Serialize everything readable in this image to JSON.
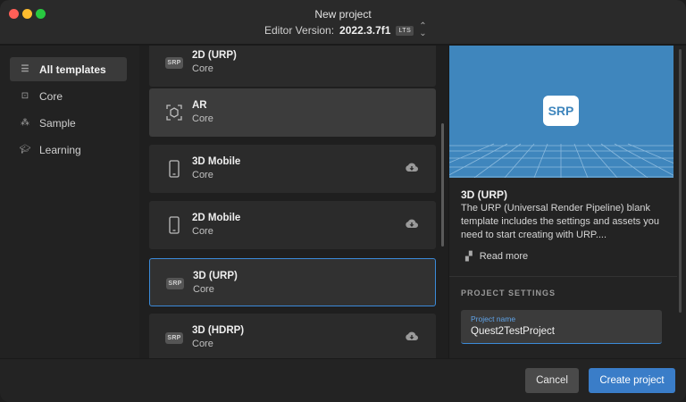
{
  "window": {
    "title": "New project"
  },
  "editor": {
    "label": "Editor Version:",
    "version": "2022.3.7f1",
    "badge": "LTS"
  },
  "sidebar": {
    "items": [
      {
        "label": "All templates",
        "icon": "list-icon",
        "active": true
      },
      {
        "label": "Core",
        "icon": "core-icon",
        "active": false
      },
      {
        "label": "Sample",
        "icon": "sample-icon",
        "active": false
      },
      {
        "label": "Learning",
        "icon": "graduation-cap-icon",
        "active": false
      }
    ]
  },
  "templates": [
    {
      "name": "2D (URP)",
      "category": "Core",
      "icon": "srp-icon",
      "download": false
    },
    {
      "name": "AR",
      "category": "Core",
      "icon": "ar-icon",
      "download": false
    },
    {
      "name": "3D Mobile",
      "category": "Core",
      "icon": "mobile-icon",
      "download": true
    },
    {
      "name": "2D Mobile",
      "category": "Core",
      "icon": "mobile-icon",
      "download": true
    },
    {
      "name": "3D (URP)",
      "category": "Core",
      "icon": "srp-icon",
      "download": false,
      "selected": true
    },
    {
      "name": "3D (HDRP)",
      "category": "Core",
      "icon": "srp-icon",
      "download": true
    }
  ],
  "srp_badge": "SRP",
  "detail": {
    "logo": "SRP",
    "title": "3D (URP)",
    "description": "The URP (Universal Render Pipeline) blank template includes the settings and assets you need to start creating with URP....",
    "read_more": "Read more",
    "settings_heading": "PROJECT SETTINGS",
    "project_name_label": "Project name",
    "project_name_value": "Quest2TestProject"
  },
  "footer": {
    "cancel_label": "Cancel",
    "create_label": "Create project"
  },
  "colors": {
    "accent": "#3b8ad9",
    "preview_bg": "#3f86bd",
    "create_button": "#3a7dc8"
  }
}
